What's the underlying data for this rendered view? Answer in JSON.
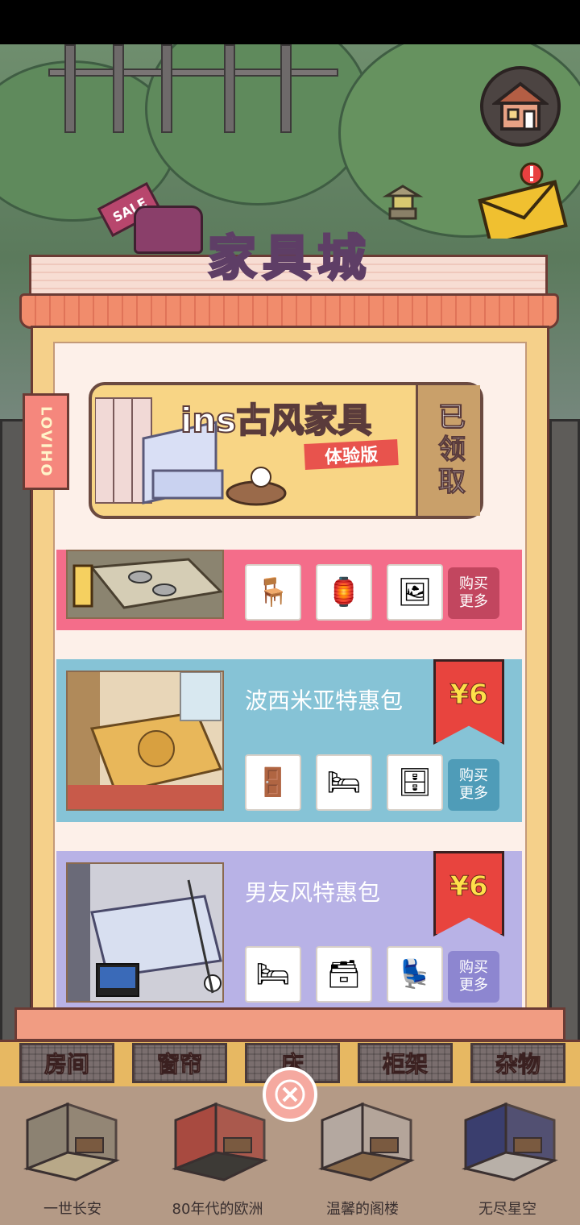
{
  "shop": {
    "title": "家具城",
    "side_tag": "LOVIHO",
    "sale_tag": "SALE"
  },
  "ins_banner": {
    "title": "ins古风家具",
    "subtitle": "体验版",
    "status": "已领取"
  },
  "packs": [
    {
      "name": "",
      "buy_label": "购买更多",
      "color": "#f46d8a",
      "button_color": "#c2465f",
      "items": [
        "table-icon",
        "lantern-icon",
        "poster-icon"
      ]
    },
    {
      "name": "波西米亚特惠包",
      "price": "¥6",
      "buy_label": "购买更多",
      "color": "#86c3d6",
      "button_color": "#4f9cb8",
      "items": [
        "screen-icon",
        "bed-icon",
        "cabinet-icon"
      ]
    },
    {
      "name": "男友风特惠包",
      "price": "¥6",
      "buy_label": "购买更多",
      "color": "#b8b2e6",
      "button_color": "#8d86d0",
      "items": [
        "bed-icon",
        "shelf-icon",
        "gaming-chair-icon"
      ]
    }
  ],
  "tabs": [
    "房间",
    "窗帘",
    "床",
    "柜架",
    "杂物"
  ],
  "rooms": [
    {
      "name": "一世长安",
      "wall": "#8c8272",
      "floor": "#b8a888"
    },
    {
      "name": "80年代的欧洲",
      "wall": "#a84a40",
      "floor": "#3d3a36"
    },
    {
      "name": "温馨的阁楼",
      "wall": "#b4a8a0",
      "floor": "#8a6a4a"
    },
    {
      "name": "无尽星空",
      "wall": "#3a3e6e",
      "floor": "#b8b0a8"
    }
  ]
}
